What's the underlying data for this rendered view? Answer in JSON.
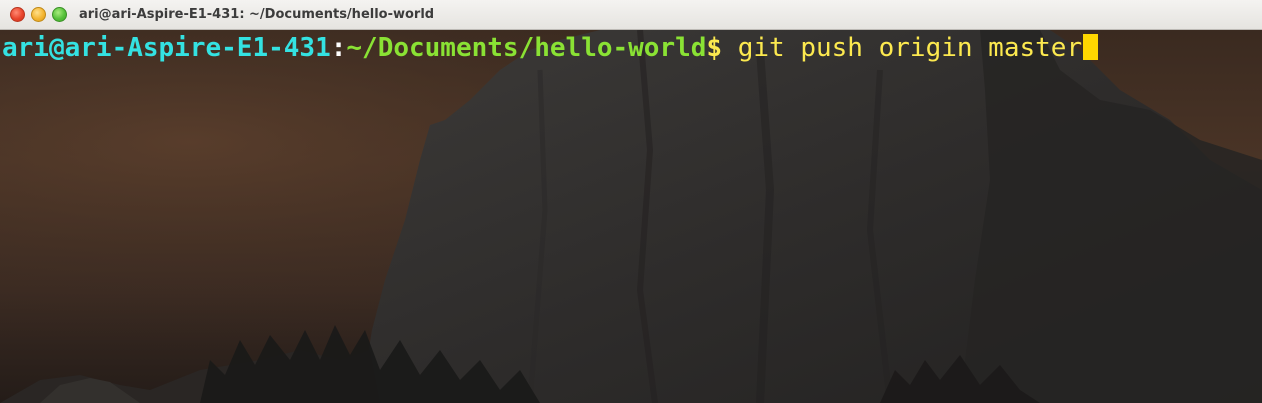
{
  "window": {
    "title": "ari@ari-Aspire-E1-431: ~/Documents/hello-world"
  },
  "titlebar_buttons": {
    "close_icon": "close-icon",
    "minimize_icon": "minimize-icon",
    "maximize_icon": "maximize-icon"
  },
  "terminal": {
    "prompt_user_host": "ari@ari-Aspire-E1-431",
    "prompt_colon": ":",
    "prompt_path": "~/Documents/hello-world",
    "prompt_symbol": "$",
    "command": " git push origin master"
  },
  "colors": {
    "user_host": "#34e2e2",
    "path": "#8ae234",
    "command": "#fce94f",
    "cursor": "#ffd700"
  }
}
